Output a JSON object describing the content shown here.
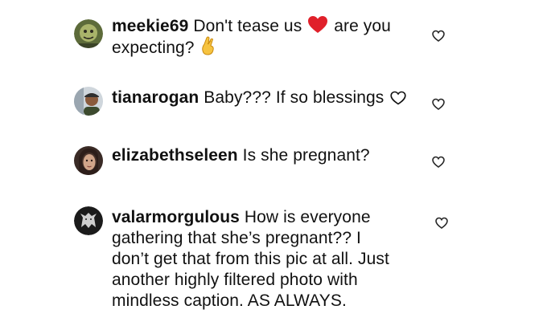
{
  "comments": [
    {
      "username": "meekie69",
      "text_before_emoji": "Don't tease us",
      "inline_emoji": "red-heart-emoji",
      "text_after_emoji": "are you",
      "line2": "expecting?",
      "line2_emoji": "crossed-fingers-emoji",
      "avatar": "green-face-avatar",
      "like_icon": "heart-outline-icon"
    },
    {
      "username": "tianarogan",
      "text": "Baby??? If so blessings",
      "inline_emoji": "white-heart-emoji",
      "avatar": "person-cap-avatar",
      "like_icon": "heart-outline-icon"
    },
    {
      "username": "elizabethseleen",
      "text": "Is she pregnant?",
      "avatar": "woman-portrait-avatar",
      "like_icon": "heart-outline-icon"
    },
    {
      "username": "valarmorgulous",
      "lines": [
        "How is everyone",
        "gathering that she’s pregnant?? I",
        "don’t get that from this pic at all. Just",
        "another highly filtered photo with",
        "mindless caption. AS ALWAYS."
      ],
      "avatar": "wolf-sigil-avatar",
      "like_icon": "heart-outline-icon"
    }
  ],
  "colors": {
    "text": "#111111",
    "heart_red": "#e0202a",
    "icon_stroke": "#262626"
  }
}
